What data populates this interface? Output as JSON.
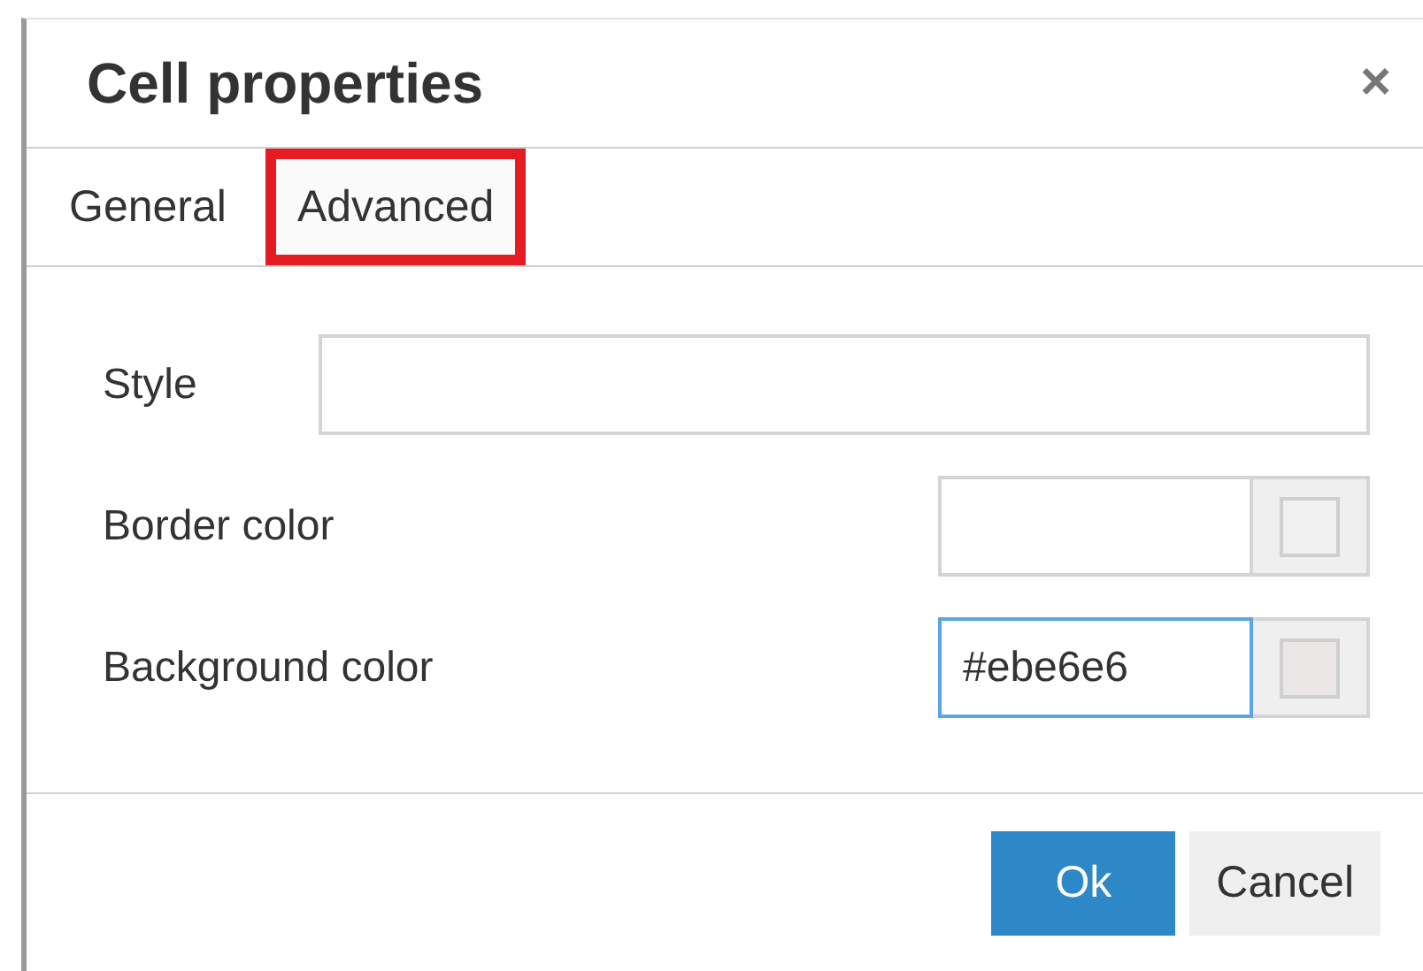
{
  "dialog": {
    "title": "Cell properties",
    "close": "×"
  },
  "tabs": [
    {
      "label": "General",
      "selected": false
    },
    {
      "label": "Advanced",
      "selected": true
    }
  ],
  "fields": [
    {
      "kind": "text",
      "label": "Style",
      "focused": false
    },
    {
      "kind": "color",
      "label": "Border color",
      "focused": false
    },
    {
      "kind": "color",
      "label": "Background color",
      "value": "#ebe6e6",
      "focused": true,
      "color": "#ebe6e6"
    }
  ],
  "buttons": [
    {
      "label": "Ok",
      "primary": true
    },
    {
      "label": "Cancel",
      "primary": false
    }
  ]
}
